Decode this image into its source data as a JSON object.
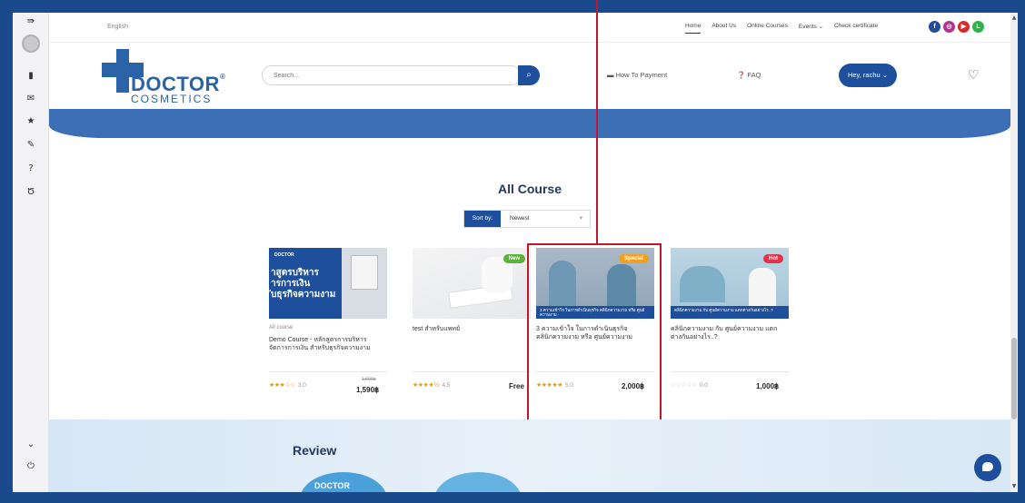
{
  "topbar": {
    "language": "English",
    "nav": [
      "Home",
      "About Us",
      "Online Courses",
      "Events",
      "Check certificate"
    ],
    "events_chevron": "⌄"
  },
  "socials": [
    {
      "icon": "facebook-icon",
      "glyph": "f",
      "color": "#1e4f9c"
    },
    {
      "icon": "instagram-icon",
      "glyph": "◎",
      "color": "#b5338f"
    },
    {
      "icon": "youtube-icon",
      "glyph": "▶",
      "color": "#d92b2b"
    },
    {
      "icon": "line-icon",
      "glyph": "L",
      "color": "#2eb34a"
    }
  ],
  "header": {
    "logo_doctor": "DOCTOR",
    "logo_reg": "®",
    "logo_cosmetics": "COSMETICS",
    "search_placeholder": "Search...",
    "search_icon": "⌕",
    "payment_icon": "▬",
    "payment_label": "How To Payment",
    "faq_icon": "❓",
    "faq_label": "FAQ",
    "user_button": "Hey, rachu ⌄",
    "wishlist_icon": "♡"
  },
  "courses_section": {
    "title": "All Course",
    "sort_label": "Sort by:",
    "sort_value": "Newest",
    "sort_caret": "▾"
  },
  "courses": [
    {
      "category": "All course",
      "title": "Demo Course - หลักสูตรการบริหารจัดการการเงิน สำหรับธุรกิจความงาม",
      "stars": "★★★☆☆",
      "rating": "3.0",
      "old_price": "1,590฿",
      "price": "1,590฿",
      "badge": "",
      "img_text": "าสูตรบริหาร\nารการเงิน\nับธุรกิจความงาม",
      "img_brand": "DOCTOR"
    },
    {
      "category": "",
      "title": "test สำหรับแพทย์",
      "stars": "★★★★½",
      "rating": "4.5",
      "old_price": "",
      "price": "Free",
      "badge": "New",
      "img_text": "",
      "img_brand": ""
    },
    {
      "category": "",
      "title": "3 ความเข้าใจ ในการดำเนินธุรกิจ คลินิกความงาม หรือ ศูนย์ความงาม",
      "stars": "★★★★★",
      "rating": "5.0",
      "old_price": "",
      "price": "2,000฿",
      "badge": "Special",
      "img_text": "3 ความเข้าใจ ในการดำเนินธุรกิจ คลินิกความงาม หรือ ศูนย์ความงาม",
      "img_brand": ""
    },
    {
      "category": "",
      "title": "คลินิกความงาม กับ ศูนย์ความงาม แตกต่างกันอย่างไร..?",
      "stars": "☆☆☆☆☆",
      "rating": "0.0",
      "old_price": "",
      "price": "1,000฿",
      "badge": "Hot",
      "img_text": "คลินิกความงาม กับ ศูนย์ความงาม แตกต่างกันอย่างไร..?",
      "img_brand": ""
    }
  ],
  "review": {
    "title": "Review",
    "badge_text": "DOCTOR"
  },
  "sidebar_icons": [
    "⇛",
    "▮",
    "✉",
    "★",
    "✎",
    "?",
    "Ծ"
  ],
  "sidebar_bottom": [
    "⌄",
    "⏻"
  ],
  "colors": {
    "brand": "#1e4f9c",
    "highlight": "#c0182a",
    "badge_new": "#5bb33a",
    "badge_special": "#f2a024",
    "badge_hot": "#e0334a"
  }
}
